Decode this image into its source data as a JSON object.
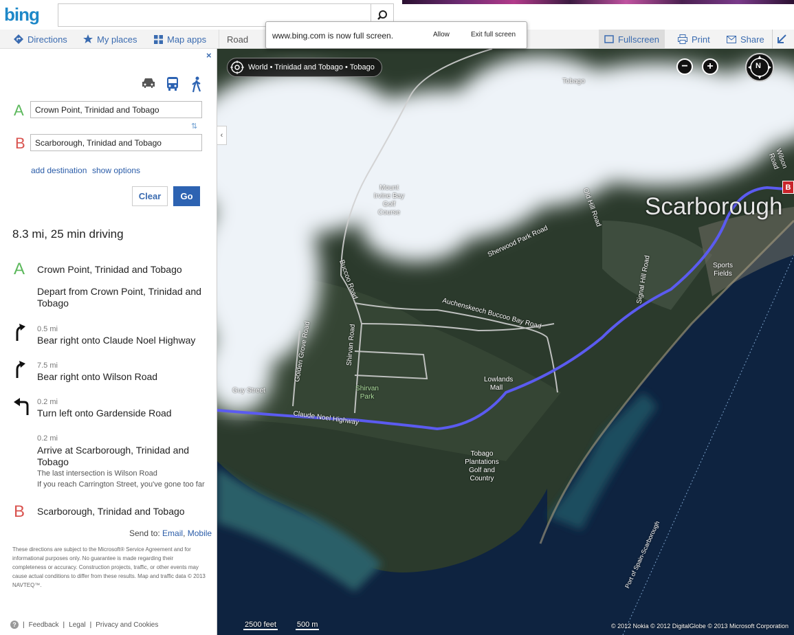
{
  "header": {
    "logo": "bing",
    "search_value": ""
  },
  "toolbar": {
    "directions": "Directions",
    "my_places": "My places",
    "map_apps": "Map apps",
    "road": "Road",
    "fullscreen": "Fullscreen",
    "print": "Print",
    "share": "Share"
  },
  "fullscreen_notice": {
    "message": "www.bing.com is now full screen.",
    "allow": "Allow",
    "exit": "Exit full screen"
  },
  "panel": {
    "close": "×",
    "waypoint_a_letter": "A",
    "waypoint_a_value": "Crown Point, Trinidad and Tobago",
    "waypoint_b_letter": "B",
    "waypoint_b_value": "Scarborough, Trinidad and Tobago",
    "swap": "⇅",
    "add_destination": "add destination",
    "show_options": "show options",
    "clear": "Clear",
    "go": "Go",
    "summary": "8.3 mi, 25 min driving",
    "start": {
      "letter": "A",
      "title": "Crown Point, Trinidad and Tobago",
      "depart": "Depart from Crown Point, Trinidad and Tobago"
    },
    "steps": [
      {
        "distance": "0.5 mi",
        "instruction": "Bear right onto Claude Noel Highway",
        "icon": "bear-right-icon"
      },
      {
        "distance": "7.5 mi",
        "instruction": "Bear right onto Wilson Road",
        "icon": "bear-right-icon"
      },
      {
        "distance": "0.2 mi",
        "instruction": "Turn left onto Gardenside Road",
        "icon": "turn-left-icon"
      },
      {
        "distance": "0.2 mi",
        "instruction": "Arrive at Scarborough, Trinidad and Tobago",
        "note1": "The last intersection is Wilson Road",
        "note2": "If you reach Carrington Street, you've gone too far"
      }
    ],
    "end": {
      "letter": "B",
      "title": "Scarborough, Trinidad and Tobago"
    },
    "send_to_label": "Send to:",
    "send_email": "Email",
    "send_mobile": "Mobile",
    "disclaimer": "These directions are subject to the Microsoft® Service Agreement and for informational purposes only. No guarantee is made regarding their completeness or accuracy. Construction projects, traffic, or other events may cause actual conditions to differ from these results. Map and traffic data © 2013 NAVTEQ™.",
    "footer": {
      "help": "?",
      "feedback": "Feedback",
      "legal": "Legal",
      "privacy": "Privacy and Cookies"
    }
  },
  "map": {
    "breadcrumb": "World • Trinidad and Tobago • Tobago",
    "collapse": "‹",
    "zoom_out": "−",
    "zoom_in": "+",
    "compass": "N",
    "pin_b": "B",
    "big_label": "Scarborough",
    "labels": {
      "tobago": "Tobago",
      "mount_irvine": "Mount Irvine Bay Golf Course",
      "sherwood": "Sherwood Park Road",
      "old_hill": "Old Hill Road",
      "signal_hill": "Signal Hill Road",
      "sports": "Sports Fields",
      "buccoo": "Buccoo Road",
      "auchenskeoch": "Auchenskeoch Buccoo Bay Road",
      "golden_grove": "Golden Grove Road",
      "shirvan_road": "Shirvan Road",
      "shirvan_park": "Shirvan Park",
      "guy_street": "Guy Street",
      "claude_noel": "Claude Noel Highway",
      "lowlands": "Lowlands Mall",
      "plantations": "Tobago Plantations Golf and Country",
      "wilson": "Wilson Road",
      "ferry": "Port of Spain-Scarborough"
    },
    "scale_feet": "2500 feet",
    "scale_m": "500 m",
    "copyright": "© 2012 Nokia   © 2012 DigitalGlobe   © 2013 Microsoft Corporation"
  },
  "colors": {
    "accent": "#2d63b2",
    "waypoint_a": "#5cb85c",
    "waypoint_b": "#d9534f",
    "route": "#5b5bf0"
  }
}
